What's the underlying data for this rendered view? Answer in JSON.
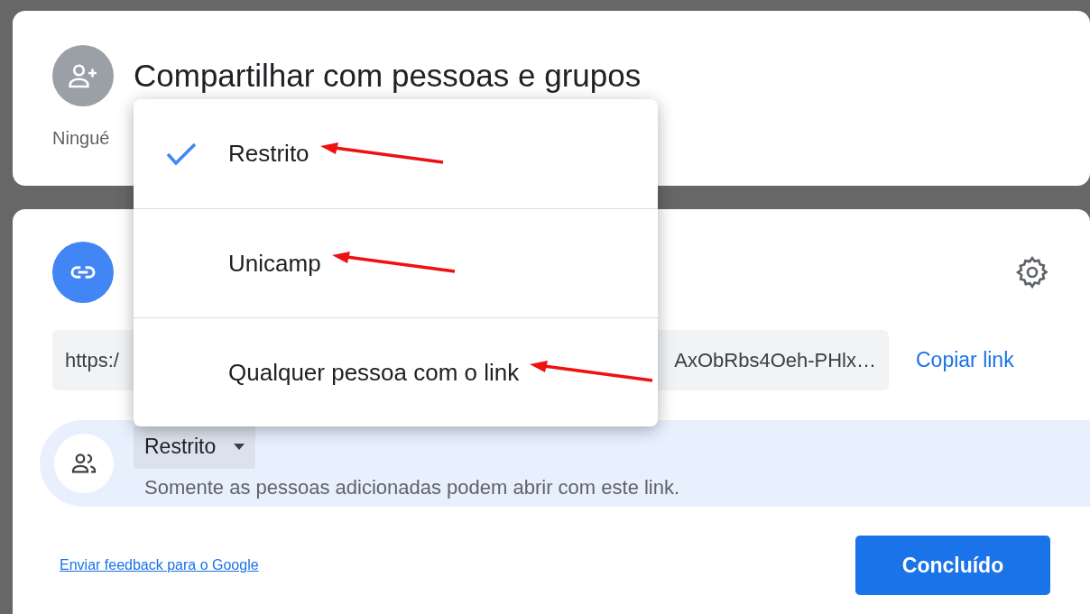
{
  "share_card": {
    "title": "Compartilhar com pessoas e grupos",
    "subtitle": "Ningué"
  },
  "link_card": {
    "link_start": "https:/",
    "link_end": "AxObRbs4Oeh-PHlx…",
    "copy_button": "Copiar link",
    "access": {
      "dropdown": "Restrito",
      "description": "Somente as pessoas adicionadas podem abrir com este link."
    },
    "feedback_link": "Enviar feedback para o Google",
    "done_button": "Concluído"
  },
  "access_menu": [
    {
      "label": "Restrito",
      "selected": true,
      "marked": true
    },
    {
      "label": "Unicamp",
      "selected": false,
      "marked": true
    },
    {
      "label": "Qualquer pessoa com o link",
      "selected": false,
      "marked": true
    }
  ]
}
